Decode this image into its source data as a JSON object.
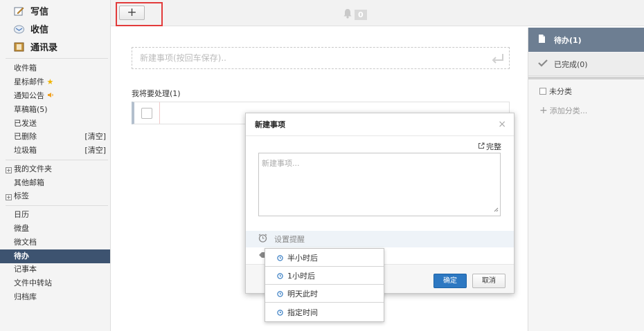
{
  "sidebar": {
    "compose": "写信",
    "inbox_big": "收信",
    "contacts": "通讯录",
    "items": [
      {
        "label": "收件箱"
      },
      {
        "label": "星标邮件"
      },
      {
        "label": "通知公告"
      },
      {
        "label": "草稿箱(5)"
      },
      {
        "label": "已发送"
      },
      {
        "label": "已删除",
        "action": "[清空]"
      },
      {
        "label": "垃圾箱",
        "action": "[清空]"
      }
    ],
    "folders": [
      {
        "label": "我的文件夹"
      },
      {
        "label": "其他邮箱"
      },
      {
        "label": "标签"
      }
    ],
    "apps": [
      {
        "label": "日历"
      },
      {
        "label": "微盘"
      },
      {
        "label": "微文档"
      },
      {
        "label": "待办"
      },
      {
        "label": "记事本"
      },
      {
        "label": "文件中转站"
      },
      {
        "label": "归档库"
      }
    ]
  },
  "toolbar": {
    "add_label": "+",
    "notification_count": "0"
  },
  "main": {
    "quick_add_placeholder": "新建事项(按回车保存)..",
    "section_label": "我将要处理(1)"
  },
  "right_panel": {
    "todo": "待办(1)",
    "done": "已完成(0)",
    "uncategorized": "未分类",
    "add_category": "添加分类..."
  },
  "dialog": {
    "title": "新建事项",
    "close": "×",
    "full_link": "完整",
    "placeholder": "新建事项...",
    "remind_label": "设置提醒",
    "ok_label": "确定",
    "cancel_label": "取消"
  },
  "remind_menu": [
    {
      "label": "半小时后"
    },
    {
      "label": "1小时后"
    },
    {
      "label": "明天此时"
    },
    {
      "label": "指定时间"
    }
  ],
  "colors": {
    "active_nav": "#3d5370",
    "right_active": "#6d7e92",
    "primary_button": "#2d78c2",
    "highlight_border": "#e23b3b"
  }
}
